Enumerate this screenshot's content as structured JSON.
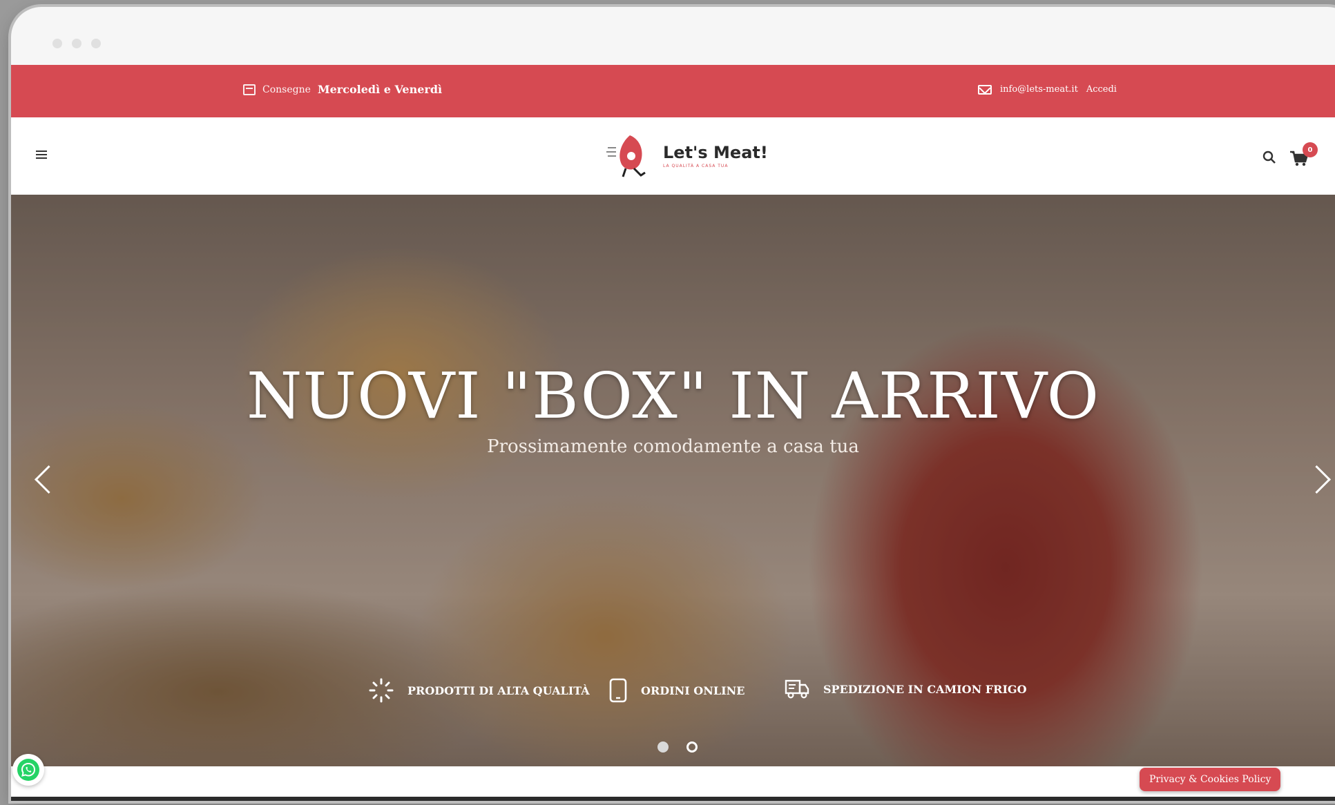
{
  "topbar": {
    "delivery_label": "Consegne",
    "delivery_days": "Mercoledì e Venerdì",
    "email": "info@lets-meat.it",
    "login": "Accedi"
  },
  "header": {
    "brand": "Let's Meat!",
    "tagline": "LA QUALITÀ A CASA TUA",
    "cart_count": "0"
  },
  "hero": {
    "title": "NUOVI \"BOX\" IN ARRIVO",
    "subtitle": "Prossimamente comodamente a casa tua",
    "features": [
      {
        "label": "PRODOTTI DI ALTA QUALITÀ",
        "icon": "spinner-icon"
      },
      {
        "label": "ORDINI ONLINE",
        "icon": "smartphone-icon"
      },
      {
        "label": "SPEDIZIONE IN CAMION FRIGO",
        "icon": "truck-icon"
      }
    ],
    "slides_active": 1
  },
  "footer": {
    "privacy": "Privacy & Cookies Policy"
  },
  "colors": {
    "accent": "#d64a52"
  }
}
